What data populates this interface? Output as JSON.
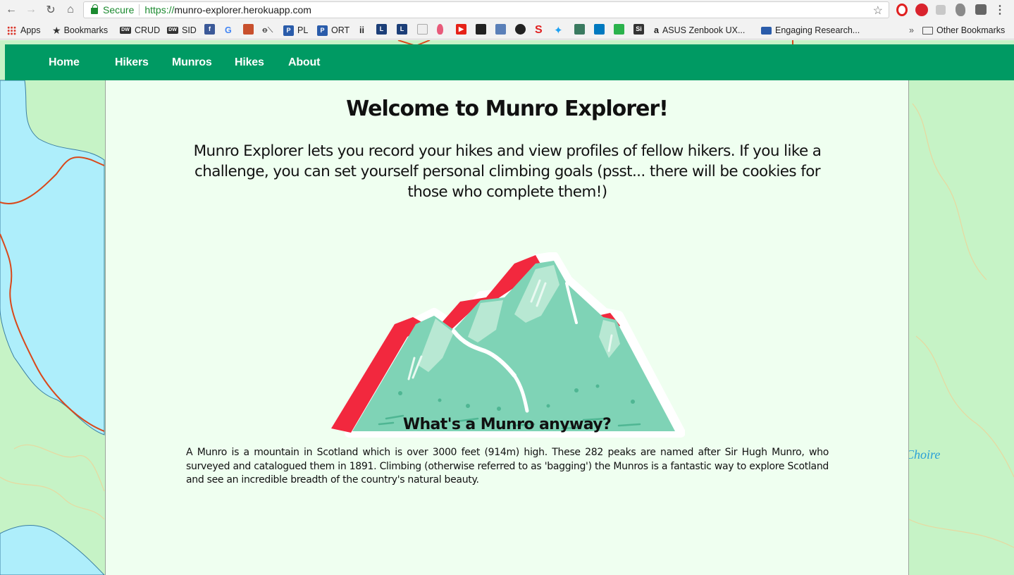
{
  "browser": {
    "secure_label": "Secure",
    "url_protocol": "https://",
    "url_host": "munro-explorer.herokuapp.com"
  },
  "bookmarks": {
    "items": [
      {
        "label": "Apps",
        "icon": "apps-grid-icon"
      },
      {
        "label": "Bookmarks",
        "icon": "star-icon"
      },
      {
        "label": "CRUD",
        "icon": "crud-icon"
      },
      {
        "label": "SID",
        "icon": "sid-icon"
      },
      {
        "label": "PL",
        "icon": "pwn-icon"
      },
      {
        "label": "ORT",
        "icon": "pwn-icon"
      },
      {
        "label": "ASUS Zenbook UX...",
        "icon": "amazon-icon"
      },
      {
        "label": "Engaging Research...",
        "icon": "book-icon"
      }
    ],
    "more": "»",
    "other": "Other Bookmarks"
  },
  "nav": {
    "items": [
      {
        "label": "Home"
      },
      {
        "label": "Hikers"
      },
      {
        "label": "Munros"
      },
      {
        "label": "Hikes"
      },
      {
        "label": "About"
      }
    ],
    "color": "#009a63"
  },
  "main": {
    "title": "Welcome to Munro Explorer!",
    "intro": "Munro Explorer lets you record your hikes and view profiles of fellow hikers. If you like a challenge, you can set yourself personal climbing goals (psst... there will be cookies for those who complete them!)",
    "subtitle": "What's a Munro anyway?",
    "description": "A Munro is a mountain in Scotland which is over 3000 feet (914m) high. These 282 peaks are named after Sir Hugh Munro, who surveyed and catalogued them in 1891. Climbing (otherwise referred to as 'bagging') the Munros is a fantastic way to explore Scotland and see an incredible breadth of the country's natural beauty."
  },
  "map": {
    "label": "Choire"
  },
  "colors": {
    "panel_bg": "#effff0",
    "map_land": "#c6f3c6",
    "map_water": "#aeeefb",
    "mountain_green": "#7fd3b6",
    "mountain_red": "#f2283e"
  }
}
